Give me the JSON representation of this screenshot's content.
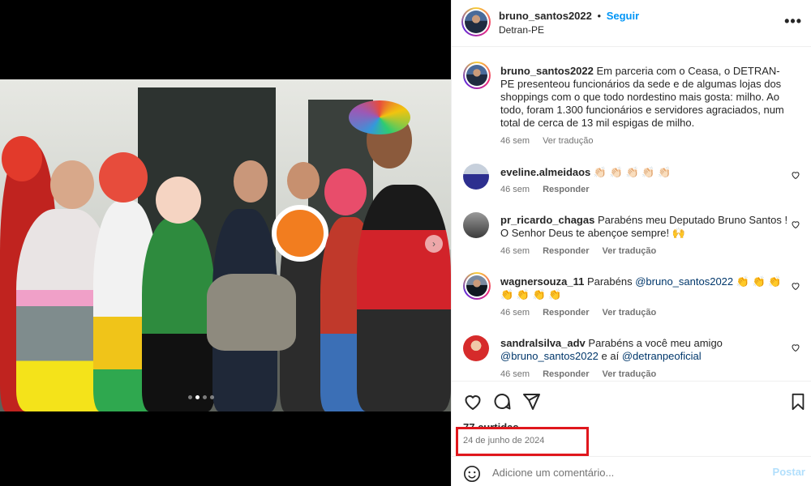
{
  "post": {
    "username": "bruno_santos2022",
    "separator": "•",
    "follow_label": "Seguir",
    "location": "Detran-PE",
    "caption": "Em parceria com o Ceasa, o DETRAN-PE presenteou funcionários da sede e de algumas lojas dos shoppings com o que todo nordestino mais gosta: milho. Ao todo, foram 1.300 funcionários e servidores agraciados, num total de cerca de 13 mil espigas de milho.",
    "caption_time": "46 sem",
    "see_translation": "Ver tradução",
    "likes_partial": "77 curtidas",
    "date": "24 de junho de 2024",
    "comment_placeholder": "Adicione um comentário...",
    "post_button": "Postar",
    "carousel": {
      "slides": 4,
      "active": 2
    }
  },
  "comments": [
    {
      "username": "eveline.almeidaos",
      "text": "👏🏻 👏🏻 👏🏻 👏🏻 👏🏻",
      "mention1": "",
      "mid": "",
      "mention2": "",
      "time": "46 sem",
      "reply": "Responder",
      "translate": ""
    },
    {
      "username": "pr_ricardo_chagas",
      "text": "Parabéns meu Deputado Bruno Santos ! O Senhor Deus te abençoe sempre! 🙌",
      "mention1": "",
      "mid": "",
      "mention2": "",
      "time": "46 sem",
      "reply": "Responder",
      "translate": "Ver tradução"
    },
    {
      "username": "wagnersouza_11",
      "text": "Parabéns",
      "mention1": "@bruno_santos2022",
      "mid": "👏 👏 👏 👏 👏 👏 👏",
      "mention2": "",
      "time": "46 sem",
      "reply": "Responder",
      "translate": "Ver tradução"
    },
    {
      "username": "sandralsilva_adv",
      "text": "Parabéns a você meu amigo",
      "mention1": "@bruno_santos2022",
      "mid": "e aí",
      "mention2": "@detranpeoficial",
      "time": "46 sem",
      "reply": "Responder",
      "translate": "Ver tradução"
    }
  ],
  "icons": [
    "more-options-icon",
    "heart-icon",
    "comment-icon",
    "share-icon",
    "bookmark-icon",
    "emoji-icon"
  ],
  "colors": {
    "link": "#0095f6",
    "mention": "#00376b",
    "highlight": "#e0171d",
    "muted": "#737373"
  }
}
